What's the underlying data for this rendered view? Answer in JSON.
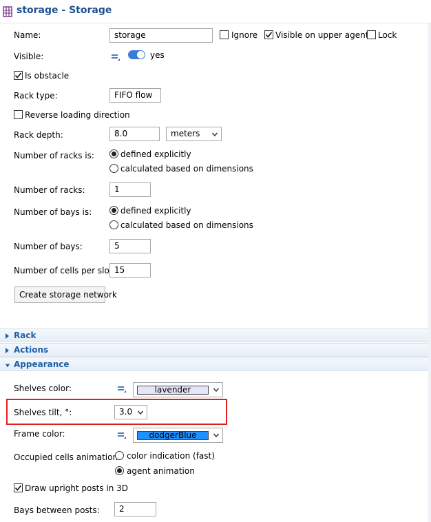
{
  "header": {
    "title": "storage - Storage"
  },
  "main": {
    "name": {
      "label": "Name:",
      "value": "storage"
    },
    "ignore_label": "Ignore",
    "visible_upper_label": "Visible on upper agent",
    "lock_label": "Lock",
    "visible": {
      "label": "Visible:",
      "value": "yes"
    },
    "is_obstacle_label": "Is obstacle",
    "rack_type": {
      "label": "Rack type:",
      "value": "FIFO flow"
    },
    "reverse_label": "Reverse loading direction",
    "rack_depth": {
      "label": "Rack depth:",
      "value": "8.0",
      "unit": "meters"
    },
    "num_racks_is": {
      "label": "Number of racks is:",
      "opt1": "defined explicitly",
      "opt2": "calculated based on dimensions"
    },
    "num_racks": {
      "label": "Number of racks:",
      "value": "1"
    },
    "num_bays_is": {
      "label": "Number of bays is:",
      "opt1": "defined explicitly",
      "opt2": "calculated based on dimensions"
    },
    "num_bays": {
      "label": "Number of bays:",
      "value": "5"
    },
    "cells_per_slot": {
      "label": "Number of cells per slot:",
      "value": "15"
    },
    "create_network_label": "Create storage network"
  },
  "sections": {
    "rack": "Rack",
    "actions": "Actions",
    "appearance": "Appearance"
  },
  "appearance": {
    "shelves_color": {
      "label": "Shelves color:",
      "value": "lavender",
      "color": "#e6e6fa"
    },
    "shelves_tilt": {
      "label": "Shelves tilt, °:",
      "value": "3.0"
    },
    "frame_color": {
      "label": "Frame color:",
      "value": "dodgerBlue",
      "color": "#1e90ff"
    },
    "occupied_anim": {
      "label": "Occupied cells animation:",
      "opt1": "color indication (fast)",
      "opt2": "agent animation"
    },
    "draw_posts_label": "Draw upright posts in 3D",
    "bays_between": {
      "label": "Bays between posts:",
      "value": "2"
    }
  },
  "colors": {
    "accent": "#1f5fa8",
    "highlight": "#e02020"
  }
}
